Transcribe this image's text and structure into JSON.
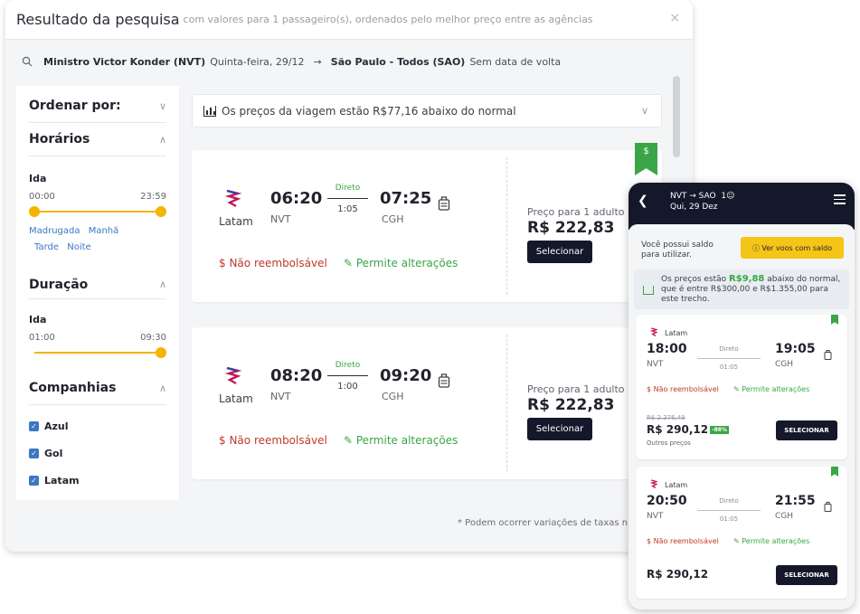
{
  "modal": {
    "title": "Resultado da pesquisa",
    "subtitle": "com valores para 1 passageiro(s), ordenados pelo melhor preço entre as agências",
    "close": "×"
  },
  "route": {
    "origin": "Ministro Victor Konder (NVT)",
    "date": "Quinta-feira, 29/12",
    "arrow": "→",
    "destination": "São Paulo - Todos (SAO)",
    "return": "Sem data de volta"
  },
  "filters": {
    "sort_title": "Ordenar por:",
    "times_title": "Horários",
    "times_sub": "Ida",
    "times_min": "00:00",
    "times_max": "23:59",
    "periods": [
      "Madrugada",
      "Manhã",
      "Tarde",
      "Noite"
    ],
    "duration_title": "Duração",
    "duration_sub": "Ida",
    "duration_min": "01:00",
    "duration_max": "09:30",
    "airlines_title": "Companhias",
    "airlines": [
      "Azul",
      "Gol",
      "Latam"
    ]
  },
  "banner": {
    "text": "Os preços da viagem estão R$77,16 abaixo do normal"
  },
  "flights": [
    {
      "airline": "Latam",
      "dep_time": "06:20",
      "dep_code": "NVT",
      "stops": "Direto",
      "duration": "1:05",
      "arr_time": "07:25",
      "arr_code": "CGH",
      "refund": "Não reembolsável",
      "changes": "Permite alterações",
      "price_label": "Preço para 1 adulto",
      "price": "R$ 222,83",
      "button": "Selecionar",
      "badge": "$"
    },
    {
      "airline": "Latam",
      "dep_time": "08:20",
      "dep_code": "NVT",
      "stops": "Direto",
      "duration": "1:00",
      "arr_time": "09:20",
      "arr_code": "CGH",
      "refund": "Não reembolsável",
      "changes": "Permite alterações",
      "price_label": "Preço para 1 adulto",
      "price": "R$ 222,83",
      "button": "Selecionar"
    }
  ],
  "footnote": "* Podem ocorrer variações de taxas n",
  "mobile": {
    "route": "NVT → SAO",
    "passengers": "1",
    "date": "Qui, 29 Dez",
    "saldo_text": "Você possui saldo para utilizar.",
    "saldo_button": "Ver voos com saldo",
    "banner_pre": "Os preços estão",
    "banner_amount": "R$9,88",
    "banner_post": "abaixo do normal, que é entre R$300,00 e R$1.355,00 para este trecho.",
    "flights": [
      {
        "airline": "Latam",
        "dep_time": "18:00",
        "dep_code": "NVT",
        "stops": "Direto",
        "duration": "01:05",
        "arr_time": "19:05",
        "arr_code": "CGH",
        "refund": "Não reembolsável",
        "changes": "Permite alterações",
        "old_price": "R$ 2.376,49",
        "price": "R$ 290,12",
        "discount": "-88%",
        "others": "Outros preços",
        "button": "SELECIONAR"
      },
      {
        "airline": "Latam",
        "dep_time": "20:50",
        "dep_code": "NVT",
        "stops": "Direto",
        "duration": "01:05",
        "arr_time": "21:55",
        "arr_code": "CGH",
        "refund": "Não reembolsável",
        "changes": "Permite alterações",
        "price": "R$ 290,12",
        "button": "SELECIONAR"
      }
    ]
  },
  "colors": {
    "accent_green": "#3aa647",
    "refund_red": "#c0392b",
    "slider_yellow": "#f5b400",
    "dark_navy": "#14182a",
    "link_blue": "#3a78c4"
  },
  "icons": {
    "search": "search-icon",
    "chart": "bar-chart-icon",
    "luggage": "luggage-icon",
    "dollar": "dollar-icon",
    "edit": "edit-icon"
  }
}
